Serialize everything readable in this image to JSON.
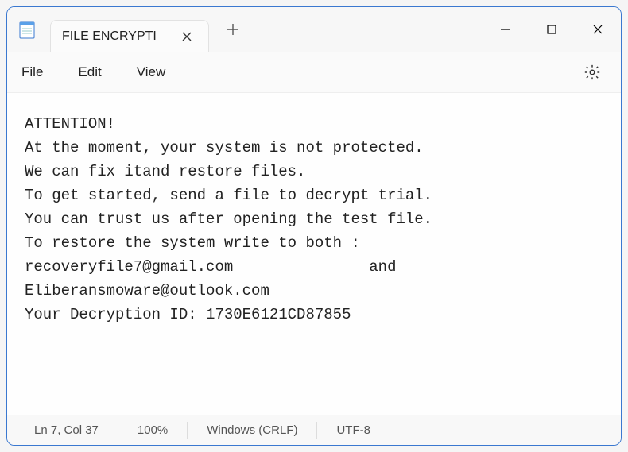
{
  "titlebar": {
    "tab_title": "FILE ENCRYPTI"
  },
  "menu": {
    "file": "File",
    "edit": "Edit",
    "view": "View"
  },
  "content": {
    "text": "ATTENTION!\nAt the moment, your system is not protected.\nWe can fix itand restore files.\nTo get started, send a file to decrypt trial.\nYou can trust us after opening the test file.\nTo restore the system write to both :\nrecoveryfile7@gmail.com               and\nEliberansmoware@outlook.com\nYour Decryption ID: 1730E6121CD87855"
  },
  "status": {
    "position": "Ln 7, Col 37",
    "zoom": "100%",
    "line_ending": "Windows (CRLF)",
    "encoding": "UTF-8"
  }
}
